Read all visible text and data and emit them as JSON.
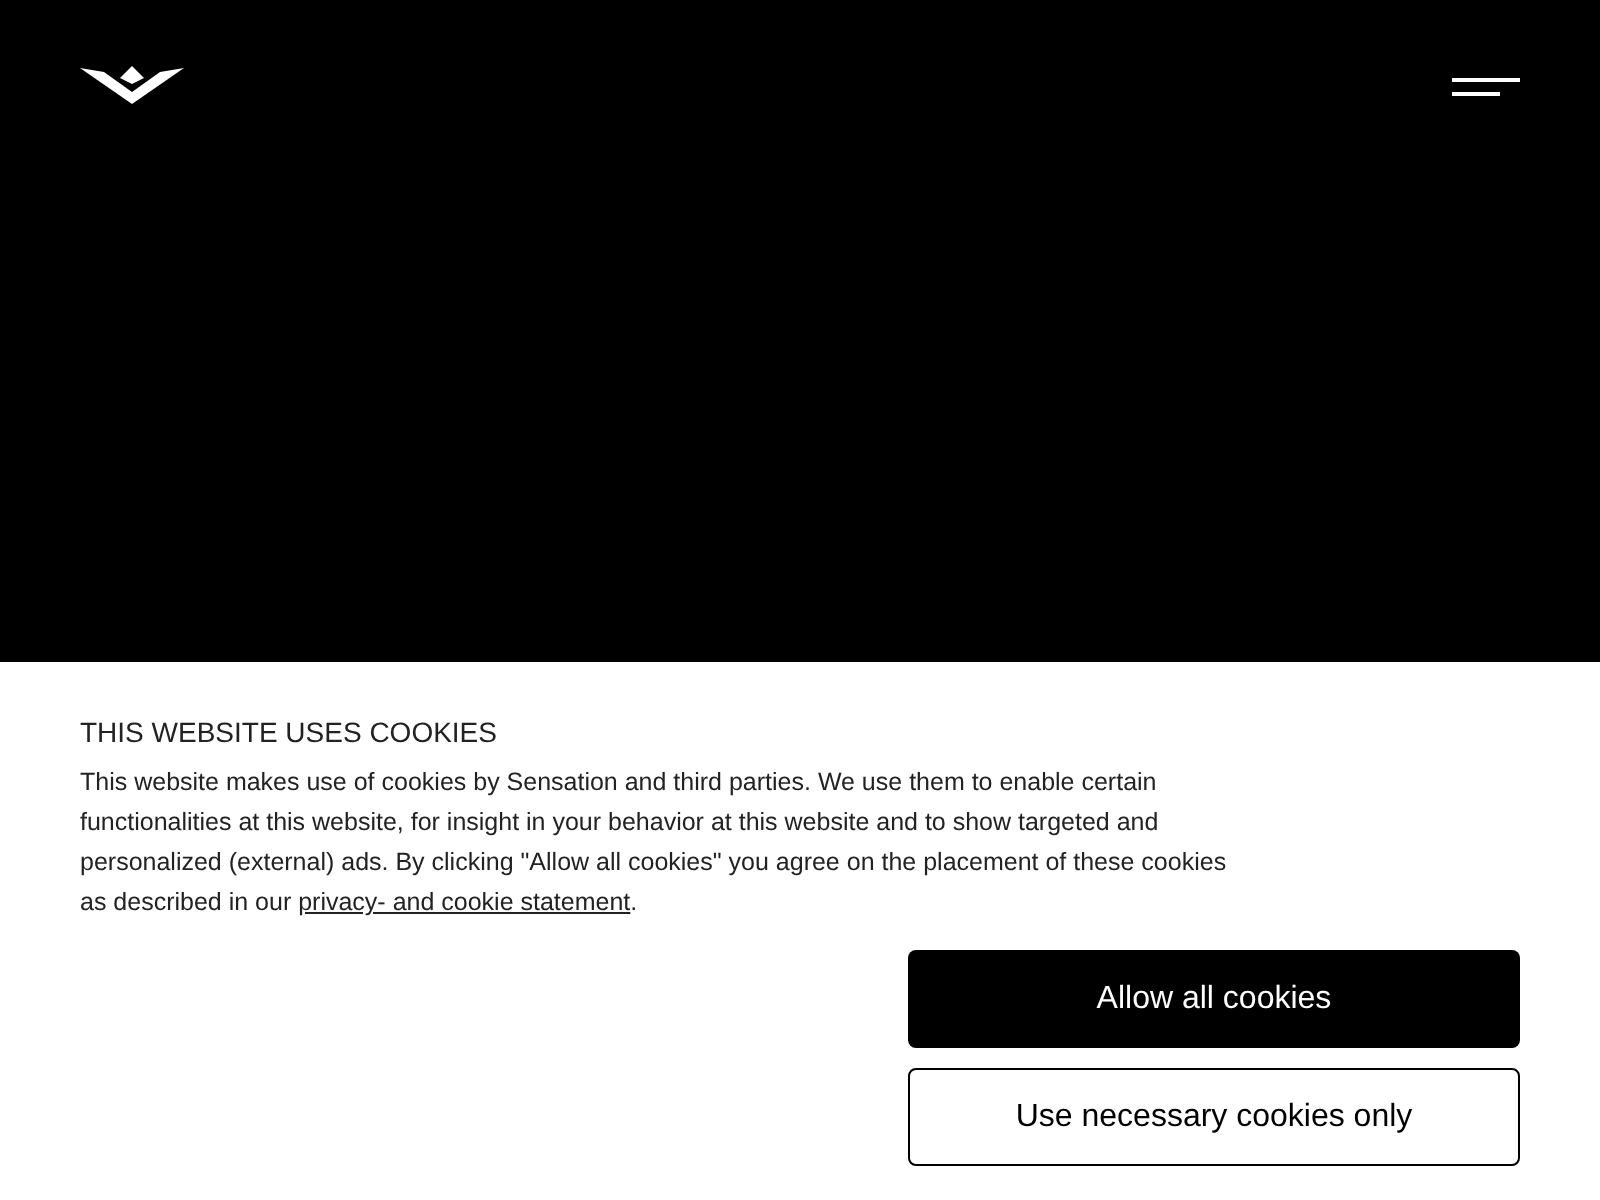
{
  "cookie_banner": {
    "title": "THIS WEBSITE USES COOKIES",
    "text": "This website makes use of cookies by Sensation and third parties. We use them to enable certain functionalities at this website, for insight in your behavior at this website and to show targeted and personalized (external) ads. By clicking \"Allow all cookies\" you agree on the placement of these cookies as described in our ",
    "link": "privacy- and cookie statement",
    "text_end": ".",
    "buttons": [
      {
        "label": "Allow all cookies",
        "kind": "primary"
      },
      {
        "label": "Use necessary cookies only",
        "kind": "secondary"
      }
    ]
  }
}
